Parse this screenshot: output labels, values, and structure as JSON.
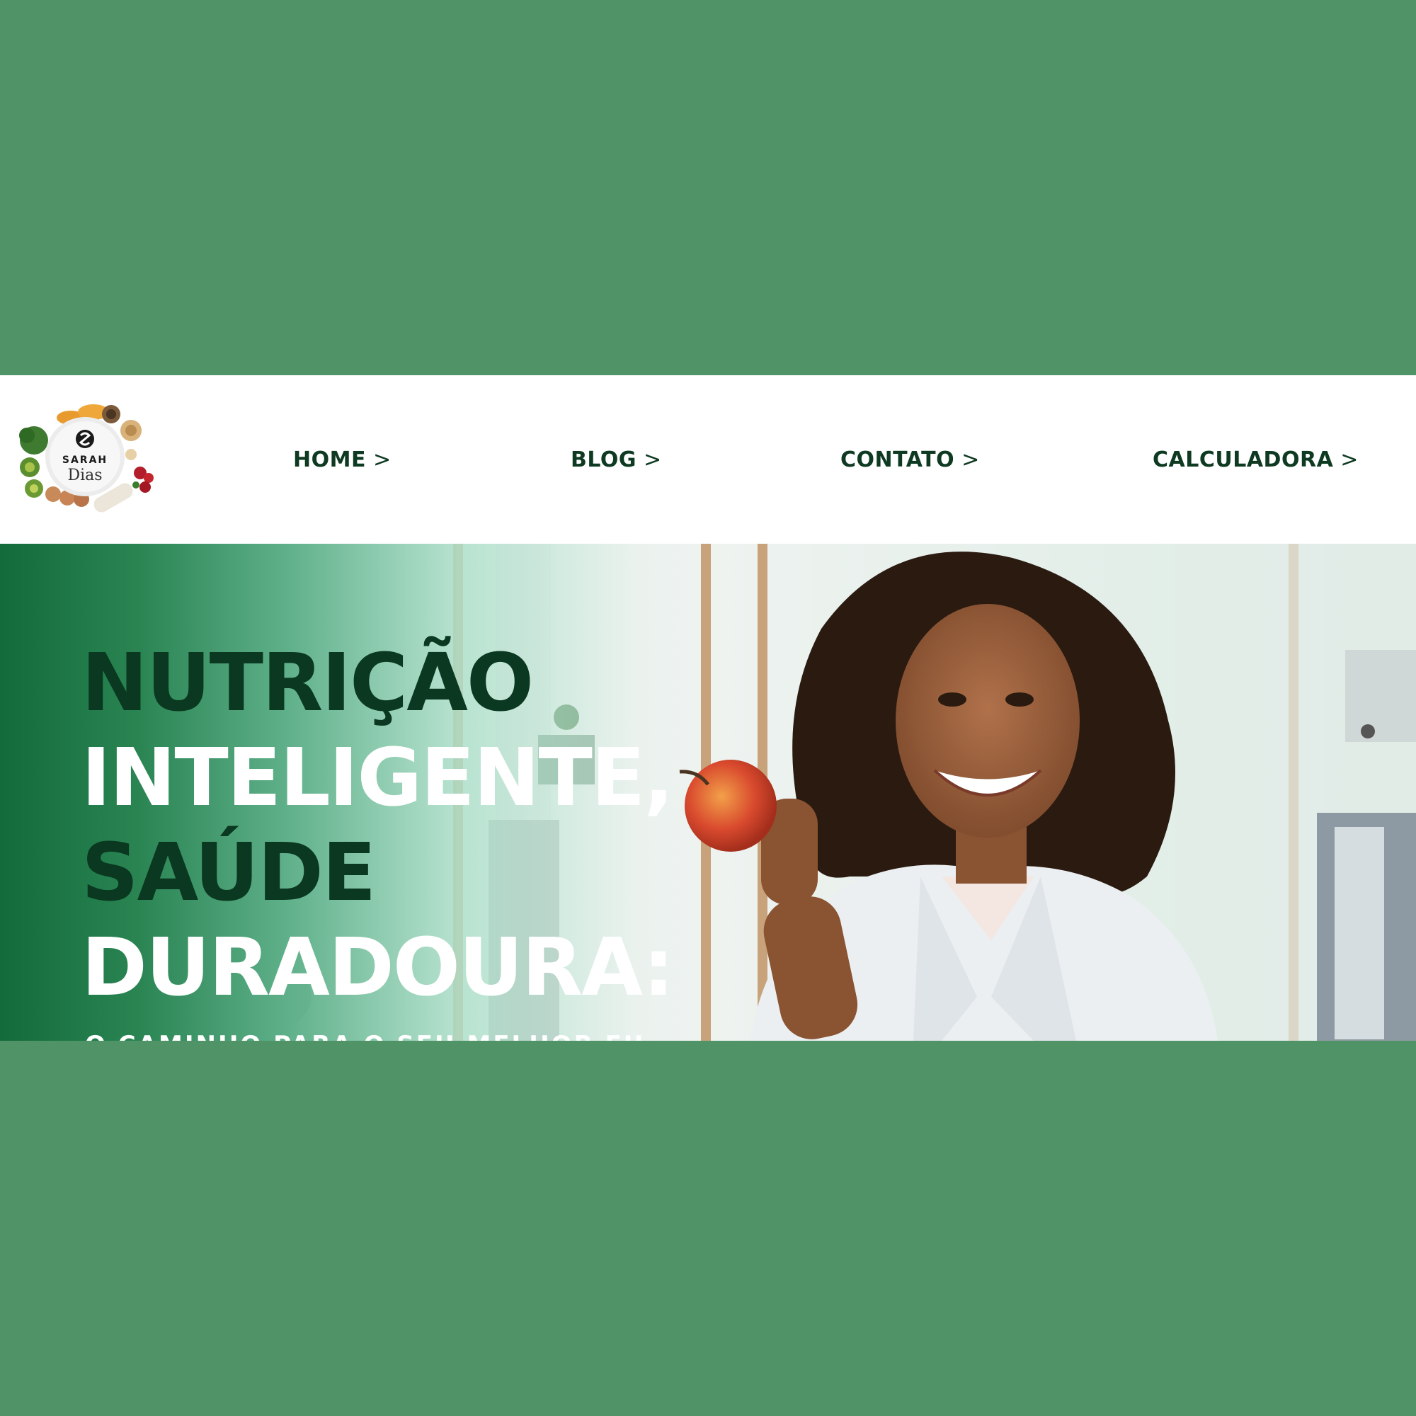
{
  "brand": {
    "logo_alt": "Sarah Dias logo",
    "logo_line1": "SARAH",
    "logo_line2": "Dias"
  },
  "nav": {
    "items": [
      {
        "label": "HOME",
        "arrow": ">"
      },
      {
        "label": "BLOG",
        "arrow": ">"
      },
      {
        "label": "CONTATO",
        "arrow": ">"
      },
      {
        "label": "CALCULADORA",
        "arrow": ">"
      }
    ]
  },
  "hero": {
    "title_lines": [
      "NUTRIÇÃO",
      "INTELIGENTE,",
      "SAÚDE",
      "DURADOURA:"
    ],
    "subtitle": "O CAMINHO PARA O SEU MELHOR EU"
  },
  "colors": {
    "page_bg": "#4f9367",
    "nav_text": "#0f3a22",
    "title_dark": "#0a3820",
    "title_light": "#ffffff"
  },
  "icons": {
    "logo": "food-plate-logo",
    "hero_image": "nutritionist-with-apple-photo",
    "decoration": "green-apple-leaf"
  }
}
